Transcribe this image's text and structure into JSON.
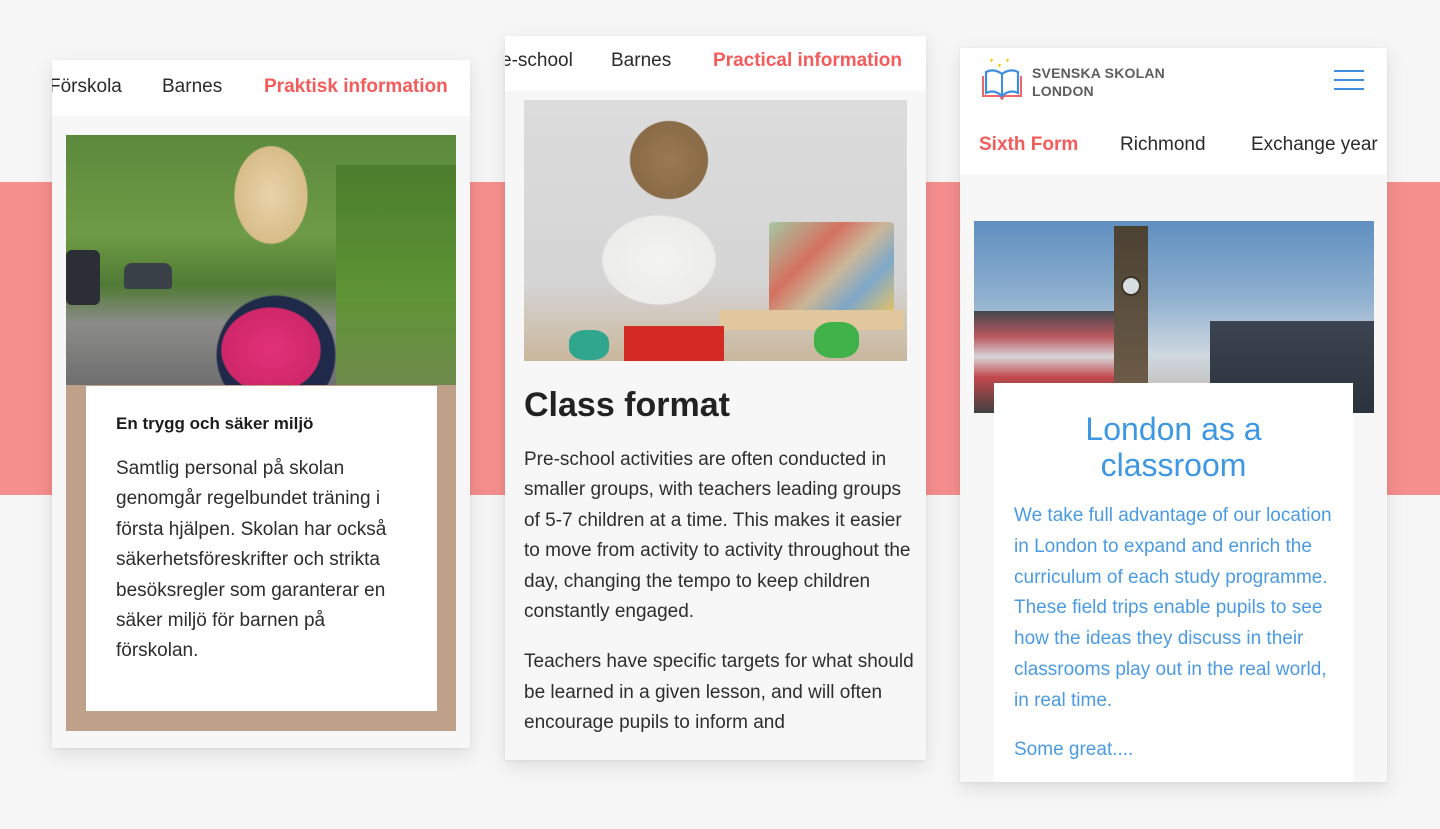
{
  "colors": {
    "accent_red": "#f45b5b",
    "band_pink": "#f58f8d",
    "brand_blue": "#3e97e2",
    "frame_tan": "#bfa18a",
    "logo_gold": "#f5c518"
  },
  "phone1": {
    "nav": [
      {
        "label": "Förskola",
        "active": false
      },
      {
        "label": "Barnes",
        "active": false
      },
      {
        "label": "Praktisk information",
        "active": true
      }
    ],
    "photo": "girl-with-pink-backpack-photo",
    "card": {
      "heading": "En trygg och säker miljö",
      "body": "Samtlig personal på skolan genomgår regelbundet träning i första hjälpen. Skolan har också säkerhetsföreskrifter och strikta besöksregler som garanterar en säker miljö för barnen på förskolan."
    }
  },
  "phone2": {
    "nav": [
      {
        "label": "e-school",
        "active": false
      },
      {
        "label": "Barnes",
        "active": false
      },
      {
        "label": "Practical information",
        "active": true
      }
    ],
    "photo": "boy-playing-with-wooden-blocks-photo",
    "title": "Class format",
    "paragraphs": [
      "Pre-school activities are often conducted in smaller groups, with teachers leading groups of 5-7 children at a time. This makes it easier to move from activity to activity throughout the day, changing the tempo to keep children constantly engaged.",
      "Teachers have specific targets for what should be learned in a given lesson, and will often encourage pupils to inform and"
    ]
  },
  "phone3": {
    "logo": {
      "line1": "SVENSKA SKOLAN",
      "line2": "LONDON"
    },
    "menu_icon": "hamburger-menu-icon",
    "nav": [
      {
        "label": "Sixth Form",
        "active": true
      },
      {
        "label": "Richmond",
        "active": false
      },
      {
        "label": "Exchange year",
        "active": false
      }
    ],
    "photo": "big-ben-westminster-photo",
    "card": {
      "heading": "London as a classroom",
      "body": "We take full advantage of our location in London to expand and enrich the curriculum of each study programme. These field trips enable pupils to see how the ideas they discuss in their classrooms play out in the real world, in real time.",
      "partial_next": "Some great...."
    }
  }
}
